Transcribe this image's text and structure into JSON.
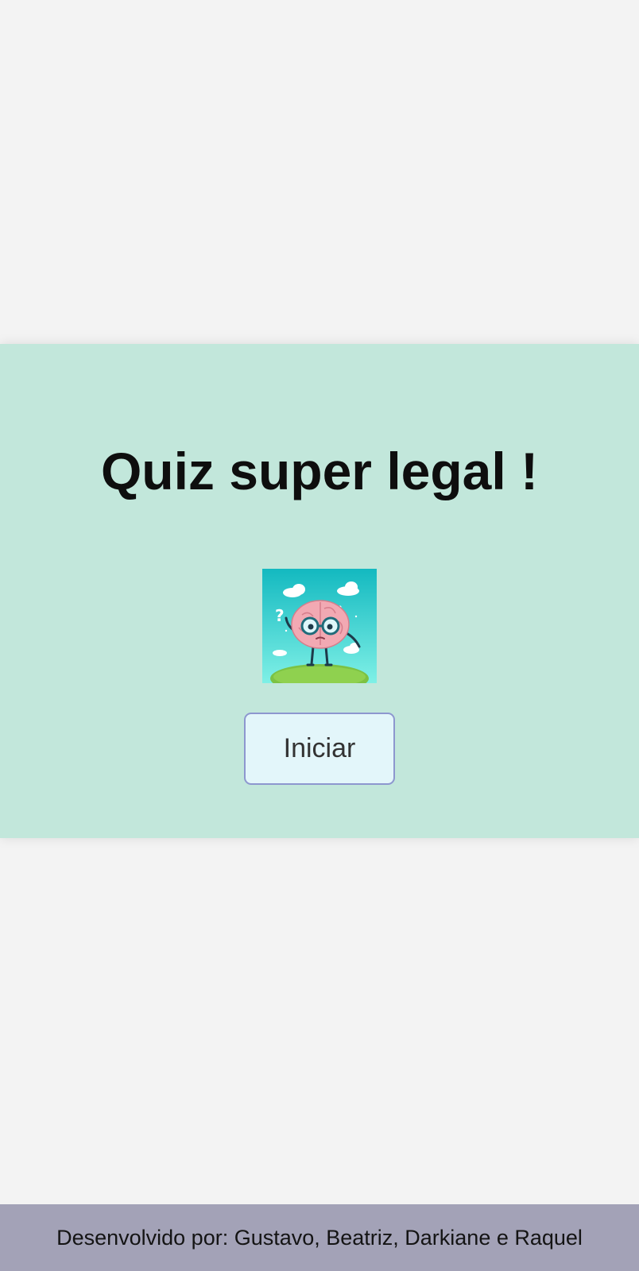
{
  "quiz": {
    "title": "Quiz super legal !",
    "mascot_icon": "brain-with-glasses-icon",
    "start_label": "Iniciar"
  },
  "footer": {
    "credits": "Desenvolvido por: Gustavo, Beatriz, Darkiane e Raquel"
  },
  "colors": {
    "page_background": "#f3f3f3",
    "card_background": "#c2e7db",
    "button_background": "#e3f6fa",
    "button_border": "#8d97cf",
    "footer_background": "#a3a2b7"
  }
}
